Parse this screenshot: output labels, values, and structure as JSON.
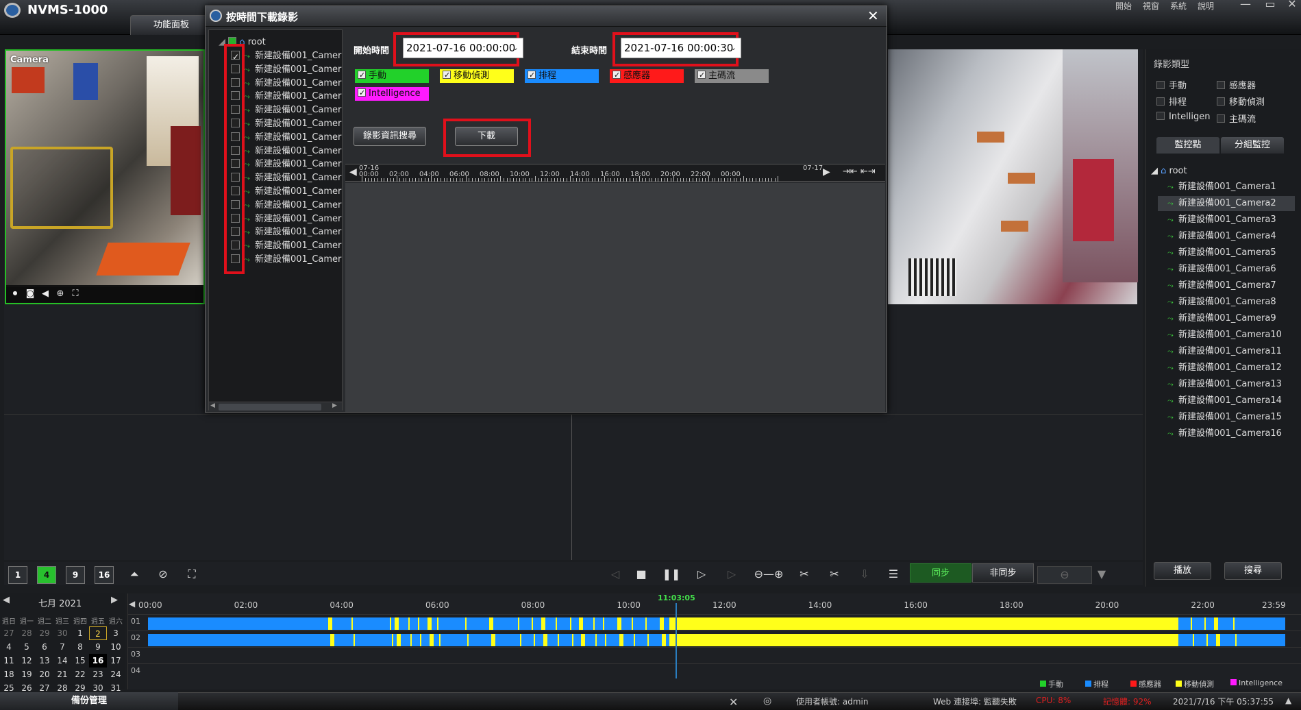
{
  "app": {
    "title": "NVMS-1000",
    "tab": "功能面板"
  },
  "topmenu": [
    "開始",
    "視窗",
    "系統",
    "說明"
  ],
  "window_controls": [
    "—",
    "▭",
    "✕"
  ],
  "camera_tile": {
    "label": "Camera"
  },
  "right_panel": {
    "title": "錄影類型",
    "types": [
      "手動",
      "感應器",
      "排程",
      "移動偵測",
      "Intelligen",
      "主碼流"
    ],
    "tabs": [
      "監控點",
      "分組監控"
    ],
    "root": "root",
    "cameras": [
      "新建設備001_Camera1",
      "新建設備001_Camera2",
      "新建設備001_Camera3",
      "新建設備001_Camera4",
      "新建設備001_Camera5",
      "新建設備001_Camera6",
      "新建設備001_Camera7",
      "新建設備001_Camera8",
      "新建設備001_Camera9",
      "新建設備001_Camera10",
      "新建設備001_Camera11",
      "新建設備001_Camera12",
      "新建設備001_Camera13",
      "新建設備001_Camera14",
      "新建設備001_Camera15",
      "新建設備001_Camera16"
    ],
    "selected_index": 1,
    "play_label": "播放",
    "search_label": "搜尋"
  },
  "toolbar": {
    "splits": [
      "1",
      "4",
      "9",
      "16"
    ],
    "active_split": "4",
    "sync": "同步",
    "nosync": "非同步"
  },
  "calendar": {
    "title": "七月 2021",
    "weekdays": [
      "週日",
      "週一",
      "週二",
      "週三",
      "週四",
      "週五",
      "週六"
    ],
    "days": [
      [
        "27",
        "28",
        "29",
        "30",
        "1",
        "2",
        "3"
      ],
      [
        "4",
        "5",
        "6",
        "7",
        "8",
        "9",
        "10"
      ],
      [
        "11",
        "12",
        "13",
        "14",
        "15",
        "16",
        "17"
      ],
      [
        "18",
        "19",
        "20",
        "21",
        "22",
        "23",
        "24"
      ],
      [
        "25",
        "26",
        "27",
        "28",
        "29",
        "30",
        "31"
      ]
    ],
    "record_day": "2",
    "today": "16"
  },
  "timeline": {
    "hours": [
      "00:00",
      "02:00",
      "04:00",
      "06:00",
      "08:00",
      "10:00",
      "12:00",
      "14:00",
      "16:00",
      "18:00",
      "20:00",
      "22:00",
      "23:59"
    ],
    "rows": [
      "01",
      "02",
      "03",
      "04"
    ],
    "current_time": "11:03:05",
    "legend": [
      {
        "label": "手動",
        "color": "#22d12a"
      },
      {
        "label": "排程",
        "color": "#1a8cff"
      },
      {
        "label": "感應器",
        "color": "#ff1a1a"
      },
      {
        "label": "移動偵測",
        "color": "#ffff1a"
      },
      {
        "label": "Intelligence",
        "color": "#ff1aff"
      }
    ],
    "colors": {
      "schedule": "#1a8cff",
      "motion": "#ffff1a"
    }
  },
  "statusbar": {
    "backup": "備份管理",
    "user": "使用者帳號: admin",
    "web": "Web 連接埠: 監聽失敗",
    "cpu": "CPU: 8%",
    "mem": "記憶體: 92%",
    "datetime": "2021/7/16 下午 05:37:55"
  },
  "dialog": {
    "title": "按時間下載錄影",
    "root": "root",
    "cameras": [
      "新建設備001_Camer",
      "新建設備001_Camer",
      "新建設備001_Camer",
      "新建設備001_Camer",
      "新建設備001_Camer",
      "新建設備001_Camer",
      "新建設備001_Camer",
      "新建設備001_Camer",
      "新建設備001_Camer",
      "新建設備001_Camer",
      "新建設備001_Camer",
      "新建設備001_Camer",
      "新建設備001_Camer",
      "新建設備001_Camer",
      "新建設備001_Camer",
      "新建設備001_Camer"
    ],
    "checked_index": 0,
    "start_label": "開始時間",
    "start_value": "2021-07-16 00:00:00",
    "end_label": "結束時間",
    "end_value": "2021-07-16 00:00:30",
    "types": [
      {
        "label": "手動",
        "color": "#22d12a",
        "text": "#111"
      },
      {
        "label": "移動偵測",
        "color": "#ffff1a",
        "text": "#111"
      },
      {
        "label": "排程",
        "color": "#1a8cff",
        "text": "#111"
      },
      {
        "label": "感應器",
        "color": "#ff1a1a",
        "text": "#111"
      },
      {
        "label": "主碼流",
        "color": "#8a8a8a",
        "text": "#111"
      },
      {
        "label": "Intelligence",
        "color": "#ff1aff",
        "text": "#111"
      }
    ],
    "search_btn": "錄影資訊搜尋",
    "download_btn": "下載",
    "ruler_start": "07-16",
    "ruler_end": "07-17",
    "ruler_hours": [
      "00:00",
      "02:00",
      "04:00",
      "06:00",
      "08:00",
      "10:00",
      "12:00",
      "14:00",
      "16:00",
      "18:00",
      "20:00",
      "22:00",
      "00:00"
    ]
  }
}
